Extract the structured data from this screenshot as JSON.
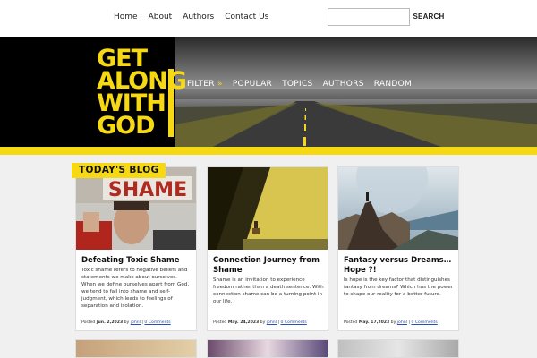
{
  "topnav": {
    "items": [
      "Home",
      "About",
      "Authors",
      "Contact Us"
    ]
  },
  "search": {
    "button_label": "SEARCH",
    "placeholder": ""
  },
  "banner": {
    "logo_lines": [
      "GET",
      "ALONG",
      "WITH",
      "GOD"
    ],
    "filter_label": "FILTER",
    "filter_arrow": "»",
    "categories": [
      "POPULAR",
      "TOPICS",
      "AUTHORS",
      "RANDOM"
    ],
    "accent_color": "#f6d912"
  },
  "section": {
    "label": "TODAY'S BLOG"
  },
  "cards": [
    {
      "title": "Defeating Toxic Shame",
      "excerpt": "Toxic shame refers to negative beliefs and statements we make about ourselves. When we define ourselves apart from God, we tend to fall into shame and self-judgment, which leads to feelings of separation and isolation.",
      "meta_prefix": "Posted",
      "date": "Jun. 2,2023",
      "by": "by",
      "author": "johnl",
      "sep": "|",
      "comments": "0 Comments",
      "image_text": "SHAME"
    },
    {
      "title": "Connection Journey from Shame",
      "excerpt": "Shame is an invitation to experience freedom rather than a death sentence. With connection shame can be a turning point in our life.",
      "meta_prefix": "Posted",
      "date": "May. 24,2023",
      "by": "by",
      "author": "johnl",
      "sep": "|",
      "comments": "0 Comments"
    },
    {
      "title": "Fantasy versus Dreams… Hope ?!",
      "excerpt": "Is hope is the key factor that distinguishes fantasy from dreams? Which has the power to shape our reality for a better future.",
      "meta_prefix": "Posted",
      "date": "May. 17,2023",
      "by": "by",
      "author": "johnl",
      "sep": "|",
      "comments": "0 Comments"
    }
  ]
}
